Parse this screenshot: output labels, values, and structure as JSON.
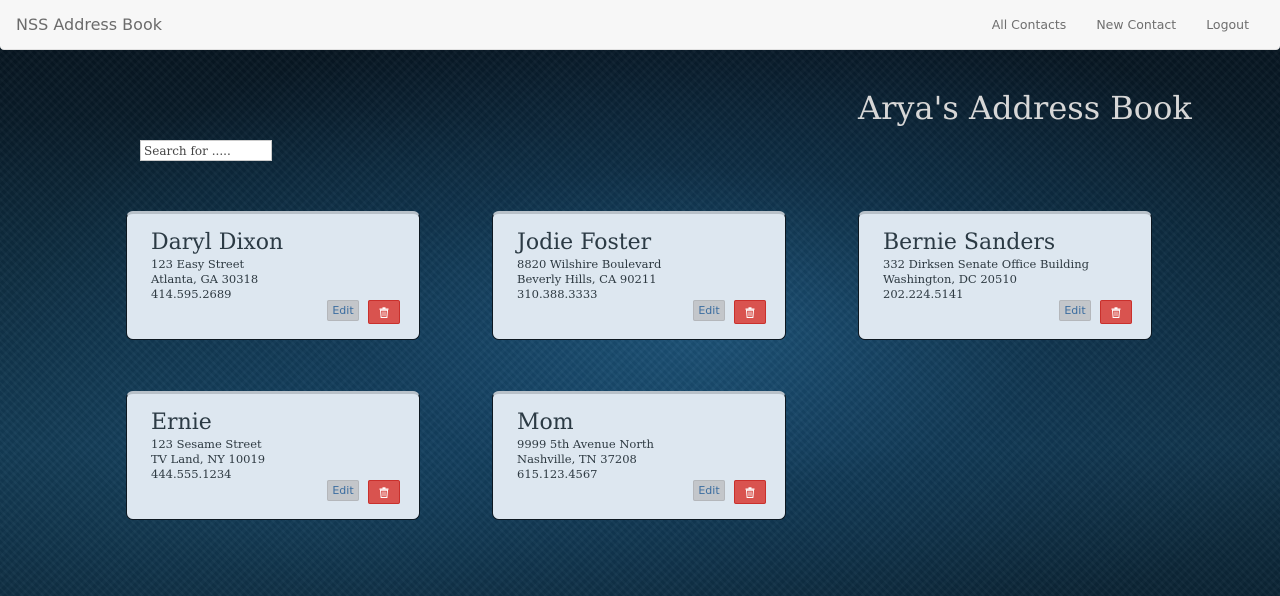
{
  "nav": {
    "brand": "NSS Address Book",
    "links": [
      "All Contacts",
      "New Contact",
      "Logout"
    ]
  },
  "page": {
    "title": "Arya's Address Book",
    "search_placeholder": "Search for ....."
  },
  "buttons": {
    "edit_label": "Edit",
    "delete_icon": "trash-icon"
  },
  "contacts": [
    {
      "name": "Daryl Dixon",
      "street": "123 Easy Street",
      "city": "Atlanta, GA 30318",
      "phone": "414.595.2689"
    },
    {
      "name": "Jodie Foster",
      "street": "8820 Wilshire Boulevard",
      "city": "Beverly Hills, CA 90211",
      "phone": "310.388.3333"
    },
    {
      "name": "Bernie Sanders",
      "street": "332 Dirksen Senate Office Building",
      "city": "Washington, DC 20510",
      "phone": "202.224.5141"
    },
    {
      "name": "Ernie",
      "street": "123 Sesame Street",
      "city": "TV Land, NY 10019",
      "phone": "444.555.1234"
    },
    {
      "name": "Mom",
      "street": "9999 5th Avenue North",
      "city": "Nashville, TN 37208",
      "phone": "615.123.4567"
    }
  ],
  "colors": {
    "card_bg": "#dde7f0",
    "delete_button": "#d9534f",
    "edit_button": "#c3c6ca",
    "title_text": "#d7d7d7"
  }
}
